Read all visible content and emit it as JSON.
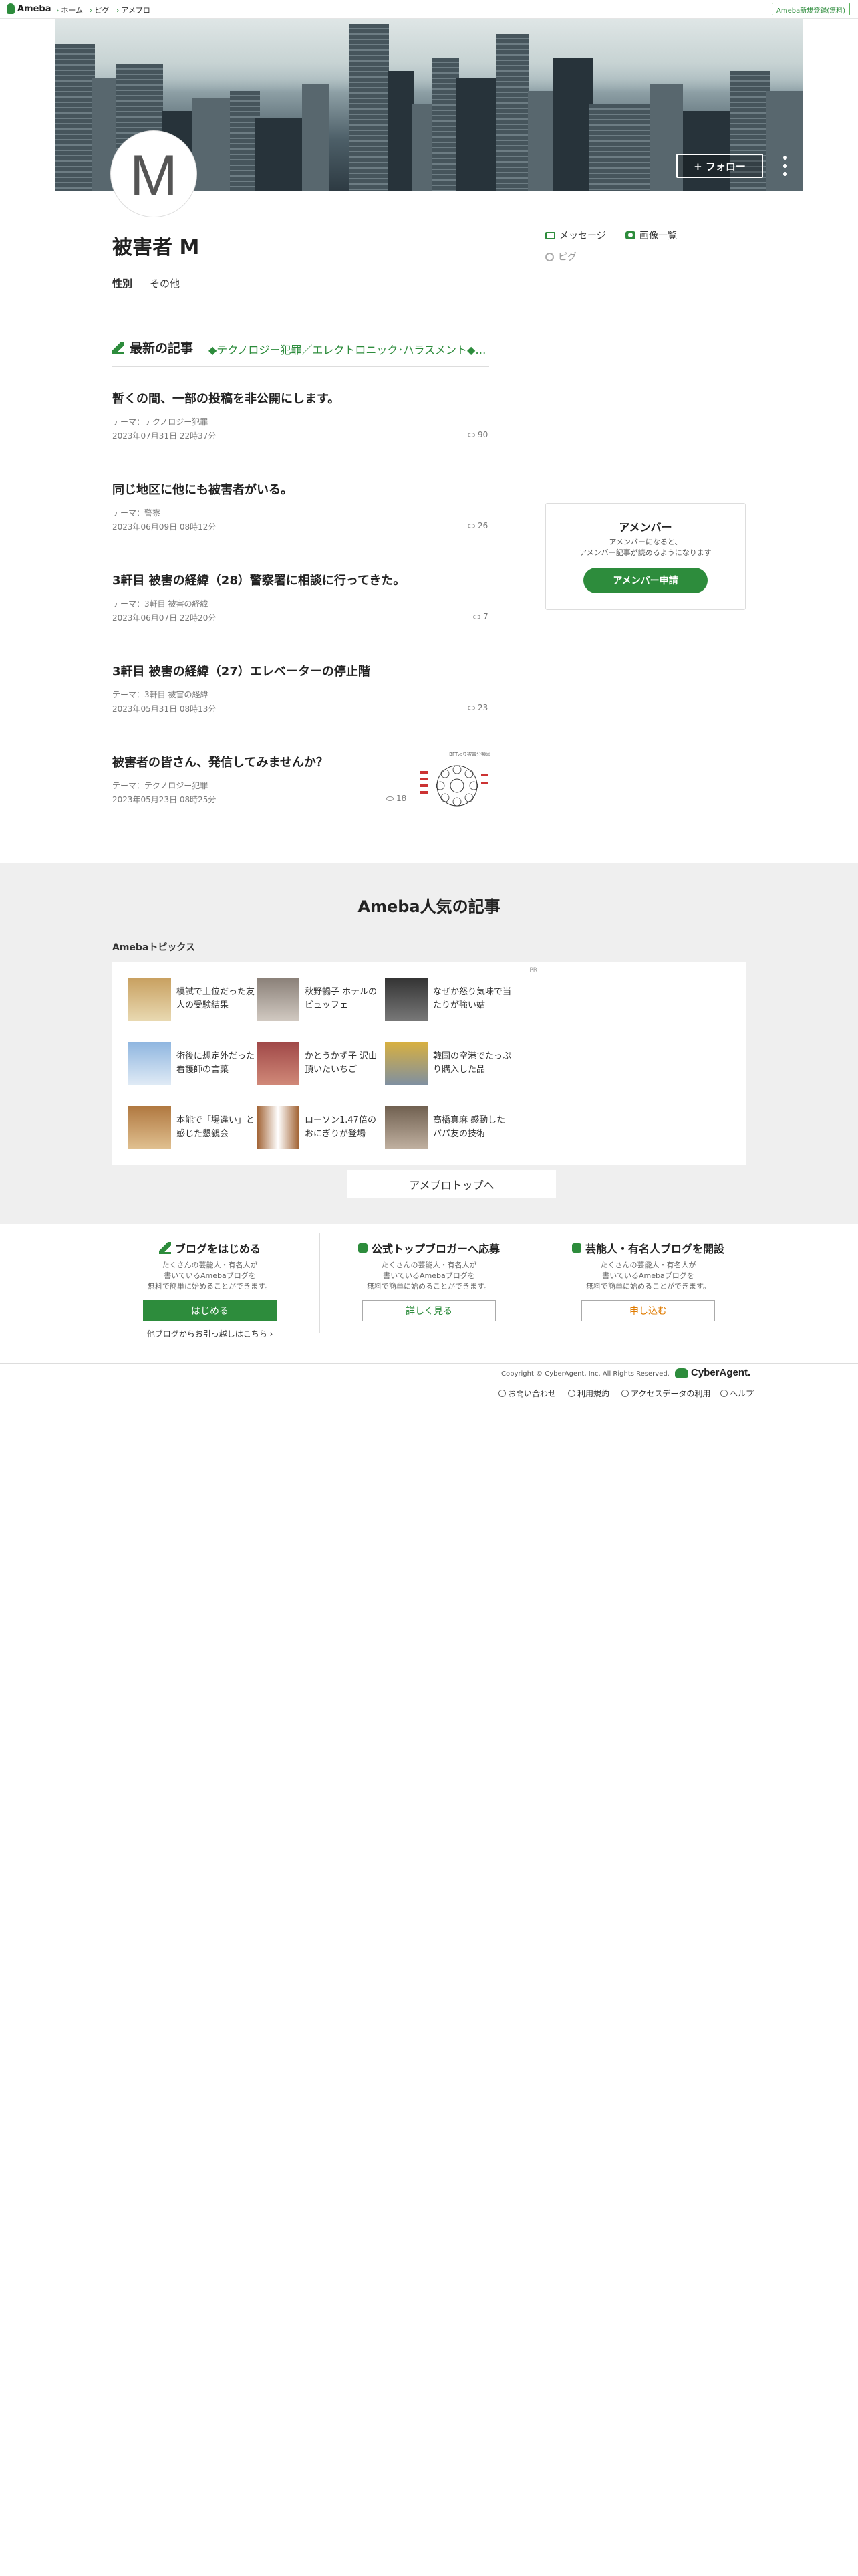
{
  "header": {
    "logo": "Ameba",
    "nav": [
      "ホーム",
      "ピグ",
      "アメブロ"
    ],
    "register": "Ameba新規登録(無料)"
  },
  "profile": {
    "avatar_letter": "M",
    "follow": "+ フォロー",
    "name": "被害者 M",
    "gender_label": "性別",
    "gender_value": "その他",
    "side_links": {
      "message": "メッセージ",
      "images": "画像一覧",
      "pigg": "ピグ"
    }
  },
  "articles": {
    "section_title": "最新の記事",
    "theme_crumb": "◆テクノロジー犯罪／エレクトロニック･ハラスメント◆被害者の会",
    "items": [
      {
        "title": "暫くの間、一部の投稿を非公開にします。",
        "theme": "テーマ：テクノロジー犯罪",
        "date": "2023年07月31日 22時37分",
        "views": "90"
      },
      {
        "title": "同じ地区に他にも被害者がいる。",
        "theme": "テーマ：警察",
        "date": "2023年06月09日 08時12分",
        "views": "26"
      },
      {
        "title": "3軒目 被害の経緯（28）警察署に相談に行ってきた。",
        "theme": "テーマ：3軒目 被害の経緯",
        "date": "2023年06月07日 22時20分",
        "views": "7"
      },
      {
        "title": "3軒目 被害の経緯（27）エレベーターの停止階",
        "theme": "テーマ：3軒目 被害の経緯",
        "date": "2023年05月31日 08時13分",
        "views": "23"
      },
      {
        "title": "被害者の皆さん、発信してみませんか？",
        "theme": "テーマ：テクノロジー犯罪",
        "date": "2023年05月23日 08時25分",
        "views": "18"
      }
    ],
    "thumb_caption": "BFTより被害分類図"
  },
  "amember": {
    "title": "アメンバー",
    "desc_line1": "アメンバーになると、",
    "desc_line2": "アメンバー記事が読めるようになります",
    "button": "アメンバー申請"
  },
  "popular": {
    "title": "Ameba人気の記事",
    "subtitle": "Amebaトピックス",
    "pr": "PR",
    "topics": [
      "模試で上位だった友人の受験結果",
      "秋野暢子 ホテルのビュッフェ",
      "なぜか怒り気味で当たりが強い姑",
      "術後に想定外だった看護師の言葉",
      "かとうかず子 沢山頂いたいちご",
      "韓国の空港でたっぷり購入した品",
      "本能で「場違い」と感じた懇親会",
      "ローソン1.47倍のおにぎりが登場",
      "高橋真麻 感動したパパ友の技術"
    ],
    "top_button": "アメブロトップへ"
  },
  "cta": [
    {
      "title": "ブログをはじめる",
      "desc1": "たくさんの芸能人・有名人が",
      "desc2": "書いているAmebaブログを",
      "desc3": "無料で簡単に始めることができます。",
      "button": "はじめる",
      "sub": "他ブログからお引っ越しはこちら ›"
    },
    {
      "title": "公式トップブロガーへ応募",
      "desc1": "たくさんの芸能人・有名人が",
      "desc2": "書いているAmebaブログを",
      "desc3": "無料で簡単に始めることができます。",
      "button": "詳しく見る"
    },
    {
      "title": "芸能人・有名人ブログを開設",
      "desc1": "たくさんの芸能人・有名人が",
      "desc2": "書いているAmebaブログを",
      "desc3": "無料で簡単に始めることができます。",
      "button": "申し込む"
    }
  ],
  "footer": {
    "copyright": "Copyright © CyberAgent, Inc. All Rights Reserved.",
    "brand": "CyberAgent.",
    "links": [
      "お問い合わせ",
      "利用規約",
      "アクセスデータの利用",
      "ヘルプ"
    ]
  },
  "colors": {
    "accent": "#2d8c3c",
    "orange": "#e07b00",
    "gray_band": "#efefef"
  }
}
